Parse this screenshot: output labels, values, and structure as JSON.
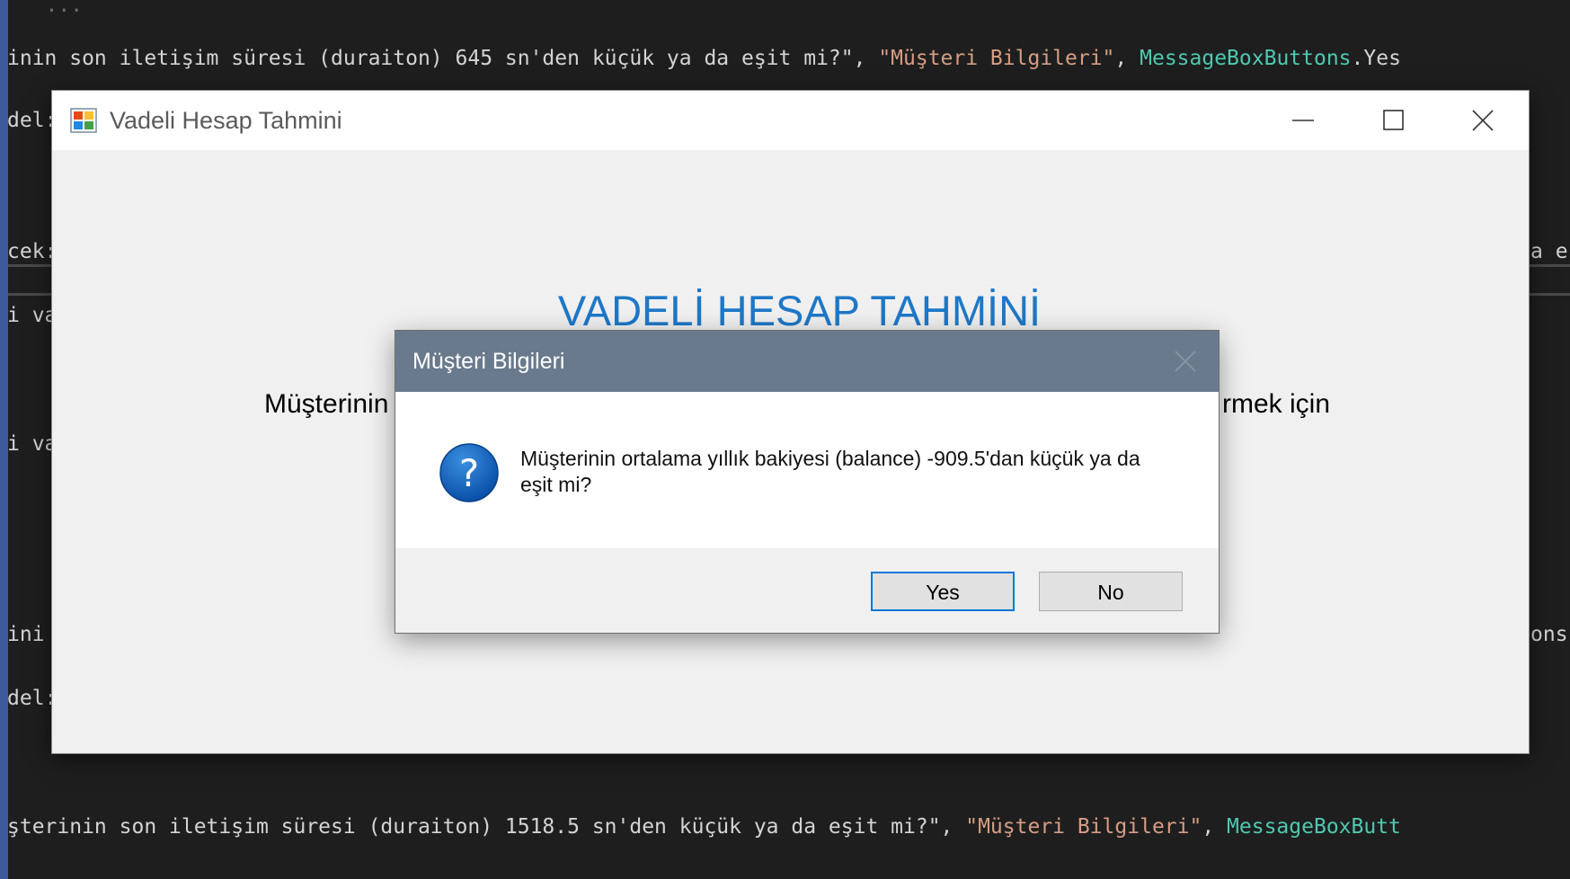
{
  "editor": {
    "line_top": "inin son iletişim süresi (duraiton) 645 sn'den küçük ya da eşit mi?\", \"Müşteri Bilgileri\", MessageBoxButtons.Yes",
    "line_top_plain": "inin son iletişim süresi (duraiton) 645 sn'den küçük ya da eşit mi?\", ",
    "line_top_str": "\"Müşteri Bilgileri\"",
    "line_top_comma": ", ",
    "line_top_cls": "MessageBoxButtons",
    "line_top_tail": ".Yes",
    "frag_del_1": "del:",
    "frag_cek": "cek:",
    "frag_iva_1": "i va",
    "frag_iva_2": "i va",
    "frag_ini": "ini",
    "frag_del_2": "del:",
    "frag_right_ae": "a e",
    "frag_right_ons": "ons",
    "line_bottom_plain": "şterinin son iletişim süresi (duraiton) 1518.5 sn'den küçük ya da eşit mi?\", ",
    "line_bottom_str": "\"Müşteri Bilgileri\"",
    "line_bottom_comma": ", ",
    "line_bottom_cls": "MessageBoxButt"
  },
  "main_window": {
    "title": "Vadeli Hesap Tahmini",
    "heading": "VADELİ HESAP TAHMİNİ",
    "text_left": "Müşterinin",
    "text_right": "rmek için"
  },
  "dialog": {
    "title": "Müşteri Bilgileri",
    "message": "Müşterinin ortalama yıllık bakiyesi (balance) -909.5'dan küçük ya da eşit mi?",
    "yes_label": "Yes",
    "no_label": "No"
  },
  "colors": {
    "editor_bg": "#1e1e1e",
    "string": "#d69d85",
    "class": "#4ec9b0",
    "heading": "#1e78c8",
    "dialog_titlebar": "#6a7a8d",
    "accent": "#0078d7"
  },
  "icons": [
    "app-icon",
    "minimize-icon",
    "maximize-icon",
    "close-icon",
    "question-icon"
  ]
}
